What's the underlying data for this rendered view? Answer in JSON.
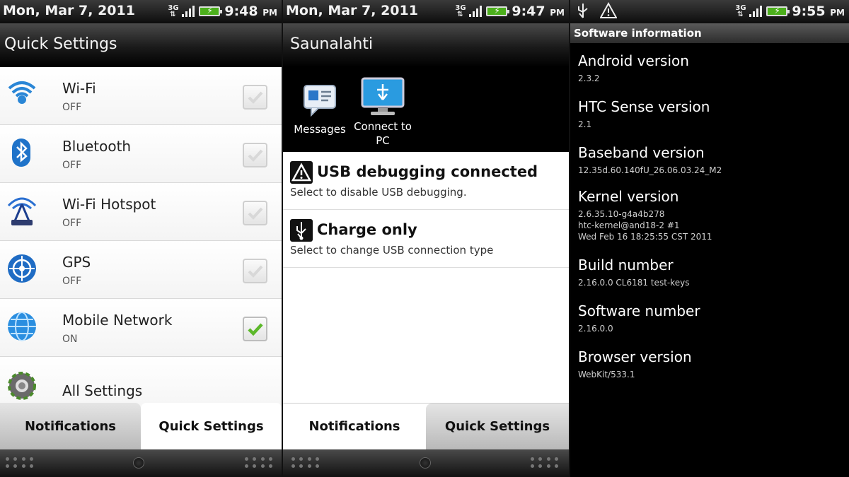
{
  "panel1": {
    "status": {
      "date": "Mon, Mar 7, 2011",
      "network": "3G",
      "time": "9:48",
      "ampm": "PM"
    },
    "title": "Quick Settings",
    "items": [
      {
        "label": "Wi-Fi",
        "state": "OFF",
        "checked": false,
        "icon": "wifi-icon"
      },
      {
        "label": "Bluetooth",
        "state": "OFF",
        "checked": false,
        "icon": "bluetooth-icon"
      },
      {
        "label": "Wi-Fi Hotspot",
        "state": "OFF",
        "checked": false,
        "icon": "wifi-hotspot-icon"
      },
      {
        "label": "GPS",
        "state": "OFF",
        "checked": false,
        "icon": "gps-icon"
      },
      {
        "label": "Mobile Network",
        "state": "ON",
        "checked": true,
        "icon": "globe-icon"
      },
      {
        "label": "All Settings",
        "icon": "gear-icon"
      }
    ],
    "tabs": {
      "left": "Notifications",
      "right": "Quick Settings",
      "active": "right"
    }
  },
  "panel2": {
    "status": {
      "date": "Mon, Mar 7, 2011",
      "network": "3G",
      "time": "9:47",
      "ampm": "PM"
    },
    "title": "Saunalahti",
    "shortcuts": [
      {
        "label": "Messages",
        "icon": "messages-icon"
      },
      {
        "label": "Connect to PC",
        "icon": "connect-to-pc-icon"
      }
    ],
    "notifications": [
      {
        "title": "USB debugging connected",
        "subtitle": "Select to disable USB debugging.",
        "icon": "warning-icon"
      },
      {
        "title": "Charge only",
        "subtitle": "Select to change USB connection type",
        "icon": "usb-icon"
      }
    ],
    "tabs": {
      "left": "Notifications",
      "right": "Quick Settings",
      "active": "left"
    }
  },
  "panel3": {
    "status": {
      "network": "3G",
      "time": "9:55",
      "ampm": "PM"
    },
    "header": "Software information",
    "items": [
      {
        "label": "Android version",
        "value": "2.3.2"
      },
      {
        "label": "HTC Sense version",
        "value": "2.1"
      },
      {
        "label": "Baseband version",
        "value": "12.35d.60.140fU_26.06.03.24_M2"
      },
      {
        "label": "Kernel version",
        "lines": [
          "2.6.35.10-g4a4b278",
          "htc-kernel@and18-2 #1",
          "Wed Feb 16 18:25:55 CST 2011"
        ]
      },
      {
        "label": "Build number",
        "value": "2.16.0.0 CL6181 test-keys"
      },
      {
        "label": "Software number",
        "value": "2.16.0.0"
      },
      {
        "label": "Browser version",
        "value": "WebKit/533.1"
      }
    ]
  },
  "colors": {
    "battery": "#4caf1c",
    "check": "#5cb82a",
    "accent_blue": "#1f73c9"
  }
}
